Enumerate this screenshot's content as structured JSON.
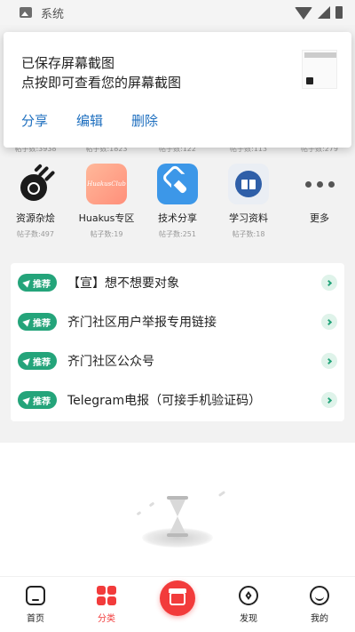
{
  "status_bar": {
    "title": "系统"
  },
  "notification": {
    "line1": "已保存屏幕截图",
    "line2": "点按即可查看您的屏幕截图",
    "actions": {
      "share": "分享",
      "edit": "编辑",
      "delete": "删除"
    }
  },
  "stats_row": [
    "帖子数:3938",
    "帖子数:1823",
    "帖子数:122",
    "帖子数:113",
    "帖子数:279"
  ],
  "categories": [
    {
      "name": "资源杂烩",
      "count": "帖子数:497",
      "icon": "resource-icon"
    },
    {
      "name": "Huakus专区",
      "count": "帖子数:19",
      "icon": "huakus-club-icon",
      "icon_text": "HuakusClub"
    },
    {
      "name": "技术分享",
      "count": "帖子数:251",
      "icon": "wrench-icon"
    },
    {
      "name": "学习资料",
      "count": "帖子数:18",
      "icon": "book-icon"
    },
    {
      "name": "更多",
      "count": "",
      "icon": "more-dots-icon"
    }
  ],
  "recommend": {
    "badge": "推荐",
    "items": [
      {
        "title": "【宣】想不想要对象"
      },
      {
        "title": "齐门社区用户举报专用链接"
      },
      {
        "title": "齐门社区公众号"
      },
      {
        "title": "Telegram电报（可接手机验证码）"
      }
    ]
  },
  "bottom_nav": {
    "items": [
      {
        "label": "首页"
      },
      {
        "label": "分类"
      },
      {
        "label": ""
      },
      {
        "label": "发现"
      },
      {
        "label": "我的"
      }
    ]
  },
  "colors": {
    "accent_red": "#f23b3b",
    "badge_green": "#24a47a",
    "action_blue": "#1e6fbf"
  }
}
